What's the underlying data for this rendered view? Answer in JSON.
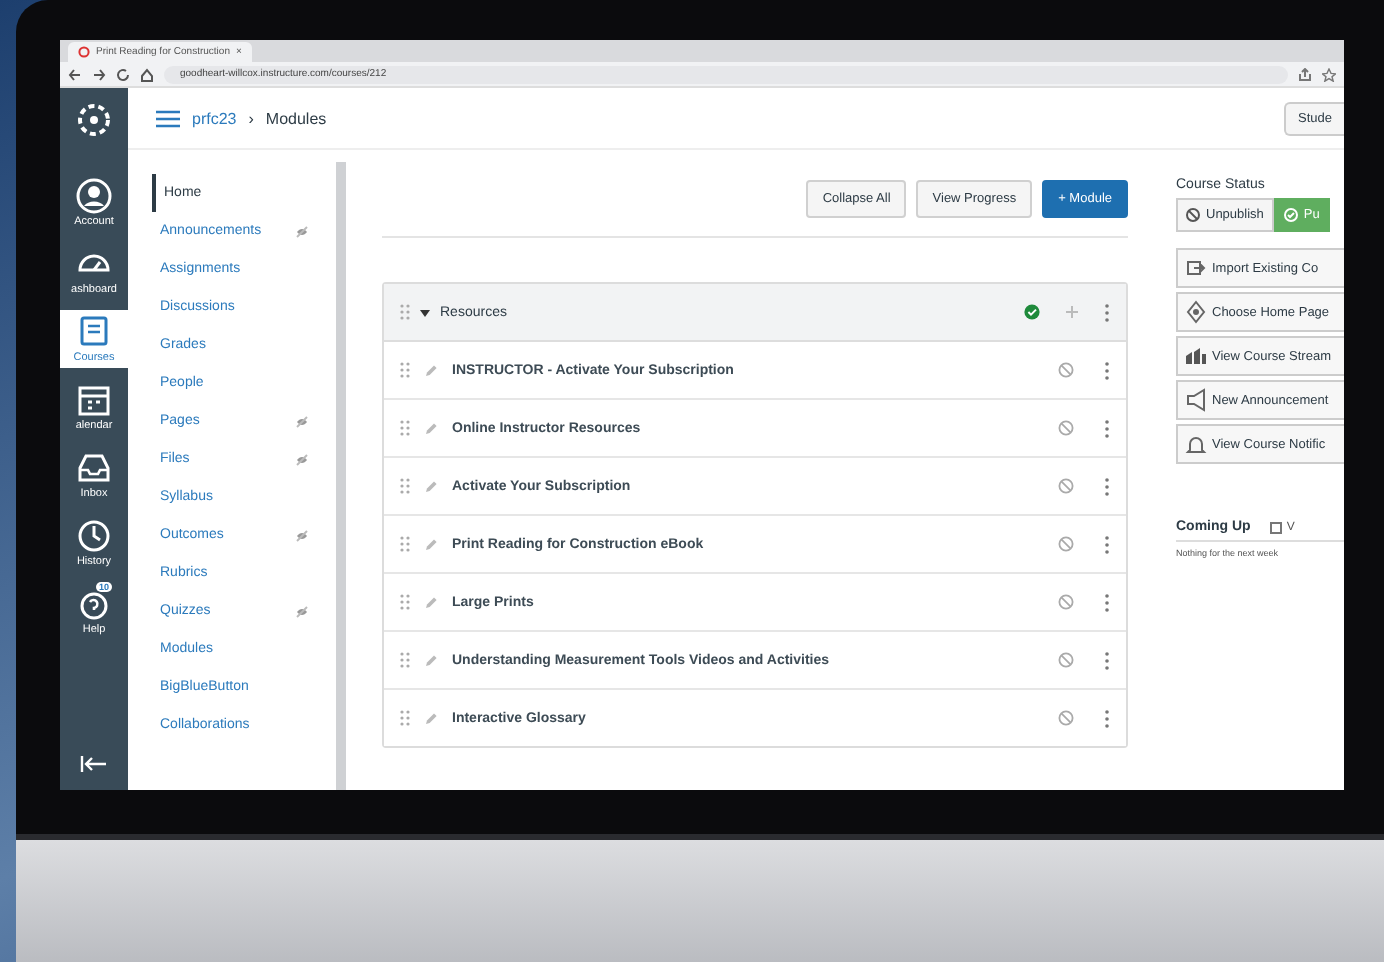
{
  "browser": {
    "tab_title": "Print Reading for Construction",
    "tab_close": "×",
    "url": "goodheart-willcox.instructure.com/courses/212"
  },
  "global_nav": [
    {
      "label": "Account",
      "kind": "account",
      "selected": false
    },
    {
      "label": "ashboard",
      "kind": "dashboard",
      "selected": false
    },
    {
      "label": "Courses",
      "kind": "courses",
      "selected": true
    },
    {
      "label": "alendar",
      "kind": "calendar",
      "selected": false
    },
    {
      "label": "Inbox",
      "kind": "inbox",
      "selected": false
    },
    {
      "label": "History",
      "kind": "history",
      "selected": false
    },
    {
      "label": "Help",
      "kind": "help",
      "selected": false,
      "badge": "10"
    }
  ],
  "header": {
    "course": "prfc23",
    "separator": "›",
    "page": "Modules",
    "student_view": "Stude"
  },
  "course_nav": [
    {
      "label": "Home",
      "selected": true,
      "hidden": false
    },
    {
      "label": "Announcements",
      "selected": false,
      "hidden": true
    },
    {
      "label": "Assignments",
      "selected": false,
      "hidden": false
    },
    {
      "label": "Discussions",
      "selected": false,
      "hidden": false
    },
    {
      "label": "Grades",
      "selected": false,
      "hidden": false
    },
    {
      "label": "People",
      "selected": false,
      "hidden": false
    },
    {
      "label": "Pages",
      "selected": false,
      "hidden": true
    },
    {
      "label": "Files",
      "selected": false,
      "hidden": true
    },
    {
      "label": "Syllabus",
      "selected": false,
      "hidden": false
    },
    {
      "label": "Outcomes",
      "selected": false,
      "hidden": true
    },
    {
      "label": "Rubrics",
      "selected": false,
      "hidden": false
    },
    {
      "label": "Quizzes",
      "selected": false,
      "hidden": true
    },
    {
      "label": "Modules",
      "selected": false,
      "hidden": false
    },
    {
      "label": "BigBlueButton",
      "selected": false,
      "hidden": false
    },
    {
      "label": "Collaborations",
      "selected": false,
      "hidden": false
    }
  ],
  "toolbar": [
    {
      "label": "Collapse All",
      "kind": "secondary"
    },
    {
      "label": "View Progress",
      "kind": "secondary"
    },
    {
      "label": "+ Module",
      "kind": "primary"
    }
  ],
  "module": {
    "title": "Resources",
    "expanded": true,
    "published": true,
    "items": [
      {
        "title": "INSTRUCTOR - Activate Your Subscription",
        "published": false
      },
      {
        "title": "Online Instructor Resources",
        "published": false
      },
      {
        "title": "Activate Your Subscription",
        "published": false
      },
      {
        "title": "Print Reading for Construction eBook",
        "published": false
      },
      {
        "title": "Large Prints",
        "published": false
      },
      {
        "title": "Understanding Measurement Tools Videos and Activities",
        "published": false
      },
      {
        "title": "Interactive Glossary",
        "published": false
      }
    ]
  },
  "sidebar": {
    "title": "Course Status",
    "status_buttons": [
      {
        "label": "Unpublish",
        "kind": "unpublish",
        "selected": false
      },
      {
        "label": "Pu",
        "kind": "publish",
        "selected": true
      }
    ],
    "actions": [
      {
        "label": "Import Existing Co",
        "kind": "import"
      },
      {
        "label": "Choose Home Page",
        "kind": "home"
      },
      {
        "label": "View Course Stream",
        "kind": "stream"
      },
      {
        "label": "New Announcement",
        "kind": "announce"
      },
      {
        "label": "View Course Notific",
        "kind": "bell"
      }
    ],
    "coming_up": {
      "title": "Coming Up",
      "link": "V",
      "empty": "Nothing for the next week"
    }
  }
}
